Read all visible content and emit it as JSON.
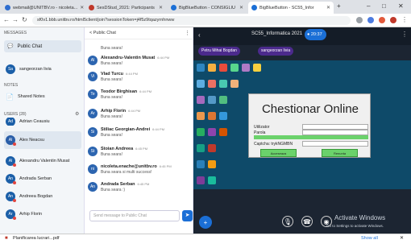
{
  "browser": {
    "tabs": [
      {
        "label": "webmail@UNITBV.ro - nicoleta...",
        "active": false,
        "color": "#2f6ecf"
      },
      {
        "label": "SesDStud_2021: Participants",
        "active": false,
        "color": "#c0392b"
      },
      {
        "label": "BigBlueButton - CONSIGLIU",
        "active": false,
        "color": "#1b6fd6"
      },
      {
        "label": "BigBlueButton - SC55_Infor",
        "active": true,
        "color": "#1b6fd6"
      }
    ],
    "url": "sf0v1.bbb.unitbv.ro/html5client/join?sessionToken=j4f5z9tqazyrnhnww",
    "download_file": "Planificarea lucrari...pdf",
    "show_all": "Show all"
  },
  "sidebar": {
    "messages_header": "MESSAGES",
    "public_chat": "Public Chat",
    "private_user": "sangeorzan livia",
    "private_initials": "Sa",
    "notes_header": "NOTES",
    "shared_notes": "Shared Notes",
    "users_header": "USERS (28)",
    "users": [
      {
        "initials": "Ad",
        "name": "Adrian Ceausiu"
      },
      {
        "initials": "Al",
        "name": "Alex Neacsu"
      },
      {
        "initials": "Al",
        "name": "Alexandru Valentin Musat"
      },
      {
        "initials": "An",
        "name": "Andrada Serban"
      },
      {
        "initials": "An",
        "name": "Andreea Bogdan"
      },
      {
        "initials": "Ar",
        "name": "Arhip Florin"
      }
    ]
  },
  "chat": {
    "back_label": "< Public Chat",
    "messages": [
      {
        "initials": "",
        "name": "",
        "time": "",
        "text": "Buna seara!"
      },
      {
        "initials": "Al",
        "name": "Alexandru-Valentin Musat",
        "time": "6:44 PM",
        "text": "Buna seara!"
      },
      {
        "initials": "Vi",
        "name": "Vlad Turcu",
        "time": "6:44 PM",
        "text": "Buna seara!"
      },
      {
        "initials": "Te",
        "name": "Teodor Birghisan",
        "time": "6:44 PM",
        "text": "Buna seara!"
      },
      {
        "initials": "Ar",
        "name": "Arhip Florin",
        "time": "6:44 PM",
        "text": "Buna seara!"
      },
      {
        "initials": "Si",
        "name": "Stiliac Georgian-Andrei",
        "time": "6:44 PM",
        "text": "Buna seara!"
      },
      {
        "initials": "St",
        "name": "Stoian Andreea",
        "time": "6:45 PM",
        "text": "Buna seara!"
      },
      {
        "initials": "ni",
        "name": "nicoleta.enache@unitbv.ro",
        "time": "6:45 PM",
        "text": "Buna seara si multi success!"
      },
      {
        "initials": "An",
        "name": "Andrada Serban",
        "time": "6:45 PM",
        "text": "Buna seara :)"
      }
    ],
    "input_placeholder": "Send message to Public Chat"
  },
  "stage": {
    "meeting_title": "SC55_Informatica 2021",
    "recording_time": "20:37",
    "presenters": [
      "Petru Mihai Bogdan",
      "sangeorzan livia"
    ],
    "dialog": {
      "title": "Chestionar Online",
      "fields": [
        "Utilizator",
        "Parola",
        "Captcha: trykNGMBN"
      ],
      "buttons": [
        "Acceseaza",
        "Renunta"
      ]
    },
    "activate_title": "Activate Windows",
    "activate_sub": "Go to Settings to activate Windows."
  }
}
